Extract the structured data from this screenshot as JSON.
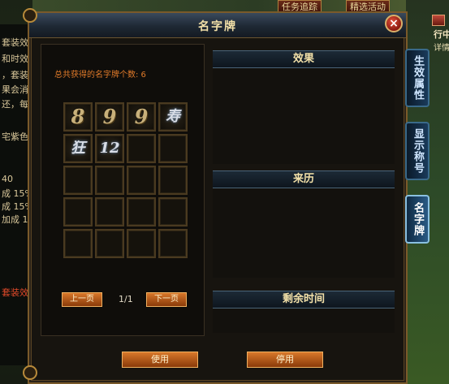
{
  "background": {
    "top_tabs": [
      "任务追踪",
      "精选活动"
    ],
    "left_texts": [
      {
        "text": "套装效",
        "color": "normal"
      },
      {
        "text": "和时效",
        "color": "normal"
      },
      {
        "text": "，套装",
        "color": "normal"
      },
      {
        "text": "果会消",
        "color": "normal"
      },
      {
        "text": "还，每",
        "color": "normal"
      },
      {
        "text": "宅紫色",
        "color": "normal"
      },
      {
        "text": "40",
        "color": "normal"
      },
      {
        "text": "成 15%",
        "color": "normal"
      },
      {
        "text": "成 15%",
        "color": "normal"
      },
      {
        "text": "加成 1",
        "color": "normal"
      },
      {
        "text": "套装效",
        "color": "red"
      }
    ],
    "right_hud": [
      "行中",
      "详情"
    ]
  },
  "dialog": {
    "title": "名字牌",
    "close_label": "×",
    "count_label": "总共获得的名字牌个数: 6",
    "slots": [
      {
        "glyph": "8",
        "style": "gold"
      },
      {
        "glyph": "9",
        "style": "gold"
      },
      {
        "glyph": "9",
        "style": "gold"
      },
      {
        "glyph": "寿",
        "style": "silver"
      },
      {
        "glyph": "狂",
        "style": "silver"
      },
      {
        "glyph": "12",
        "style": "silver"
      },
      {
        "glyph": "",
        "style": ""
      },
      {
        "glyph": "",
        "style": ""
      },
      {
        "glyph": "",
        "style": ""
      },
      {
        "glyph": "",
        "style": ""
      },
      {
        "glyph": "",
        "style": ""
      },
      {
        "glyph": "",
        "style": ""
      },
      {
        "glyph": "",
        "style": ""
      },
      {
        "glyph": "",
        "style": ""
      },
      {
        "glyph": "",
        "style": ""
      },
      {
        "glyph": "",
        "style": ""
      },
      {
        "glyph": "",
        "style": ""
      },
      {
        "glyph": "",
        "style": ""
      },
      {
        "glyph": "",
        "style": ""
      },
      {
        "glyph": "",
        "style": ""
      }
    ],
    "pager": {
      "prev": "上一页",
      "page": "1/1",
      "next": "下一页"
    },
    "sections": {
      "effect": "效果",
      "origin": "来历",
      "time_left": "剩余时间"
    },
    "buttons": {
      "use": "使用",
      "stop": "停用"
    }
  },
  "side_tabs": [
    {
      "label": "生效属性",
      "active": false
    },
    {
      "label": "显示称号",
      "active": false
    },
    {
      "label": "名字牌",
      "active": true
    }
  ],
  "colors": {
    "accent_orange": "#e07a2a",
    "gold": "#f2e0a8",
    "frame": "#7a5a2a"
  }
}
